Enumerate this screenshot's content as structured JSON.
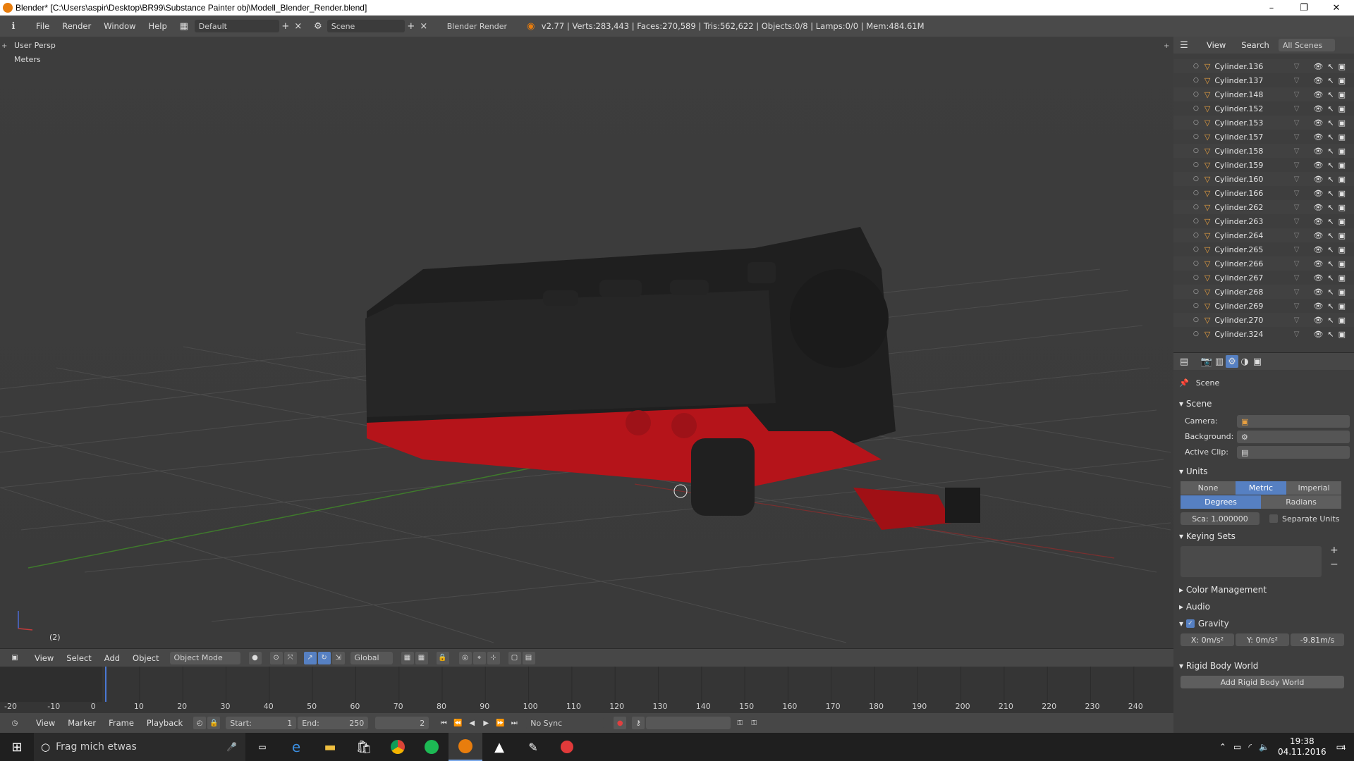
{
  "window": {
    "title": "Blender* [C:\\Users\\aspir\\Desktop\\BR99\\Substance Painter obj\\Modell_Blender_Render.blend]",
    "min": "–",
    "max": "❐",
    "close": "✕"
  },
  "info_header": {
    "menus": [
      "File",
      "Render",
      "Window",
      "Help"
    ],
    "layout": "Default",
    "scene": "Scene",
    "engine": "Blender Render",
    "stats": "v2.77 | Verts:283,443 | Faces:270,589 | Tris:562,622 | Objects:0/8 | Lamps:0/0 | Mem:484.61M"
  },
  "viewport": {
    "view_name": "User Persp",
    "units": "Meters",
    "frame_indicator": "(2)",
    "colors": {
      "body": "#222222",
      "frame_red": "#b5141a",
      "grid": "#4a4a4a",
      "x_axis": "#7a2f2f",
      "y_axis": "#3f7a2c"
    }
  },
  "view3d_header": {
    "menus": [
      "View",
      "Select",
      "Add",
      "Object"
    ],
    "mode": "Object Mode",
    "orientation": "Global"
  },
  "timeline": {
    "ticks": [
      "-20",
      "-10",
      "0",
      "10",
      "20",
      "30",
      "40",
      "50",
      "60",
      "70",
      "80",
      "90",
      "100",
      "110",
      "120",
      "130",
      "140",
      "150",
      "160",
      "170",
      "180",
      "190",
      "200",
      "210",
      "220",
      "230",
      "240"
    ],
    "menus": [
      "View",
      "Marker",
      "Frame",
      "Playback"
    ],
    "start_label": "Start:",
    "start": "1",
    "end_label": "End:",
    "end": "250",
    "current": "2",
    "sync": "No Sync"
  },
  "outliner": {
    "header": [
      "View",
      "Search",
      "All Scenes"
    ],
    "items": [
      "Cylinder.136",
      "Cylinder.137",
      "Cylinder.148",
      "Cylinder.152",
      "Cylinder.153",
      "Cylinder.157",
      "Cylinder.158",
      "Cylinder.159",
      "Cylinder.160",
      "Cylinder.166",
      "Cylinder.262",
      "Cylinder.263",
      "Cylinder.264",
      "Cylinder.265",
      "Cylinder.266",
      "Cylinder.267",
      "Cylinder.268",
      "Cylinder.269",
      "Cylinder.270",
      "Cylinder.324"
    ]
  },
  "properties": {
    "breadcrumb": "Scene",
    "scene_panel": "Scene",
    "camera_label": "Camera:",
    "background_label": "Background:",
    "active_clip_label": "Active Clip:",
    "units_panel": "Units",
    "unit_options": [
      "None",
      "Metric",
      "Imperial"
    ],
    "rotation_options": [
      "Degrees",
      "Radians"
    ],
    "scale": "Sca: 1.000000",
    "separate_units": "Separate Units",
    "keying_sets_panel": "Keying Sets",
    "color_management_panel": "Color Management",
    "audio_panel": "Audio",
    "gravity_panel": "Gravity",
    "gravity_x": "X: 0m/s²",
    "gravity_y": "Y: 0m/s²",
    "gravity_z": "-9.81m/s",
    "rigid_body_panel": "Rigid Body World",
    "add_rigid_body": "Add Rigid Body World"
  },
  "taskbar": {
    "search_placeholder": "Frag mich etwas",
    "time": "19:38",
    "date": "04.11.2016",
    "notification_count": "4"
  }
}
